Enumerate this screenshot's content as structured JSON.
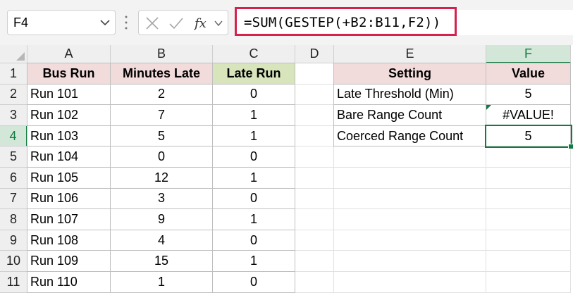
{
  "formula_bar": {
    "name_box": "F4",
    "formula": "=SUM(GESTEP(+B2:B11,F2))",
    "cancel_icon": "close-icon",
    "enter_icon": "check-icon",
    "function_icon": "fx-icon"
  },
  "columns": [
    "A",
    "B",
    "C",
    "D",
    "E",
    "F"
  ],
  "rows": [
    "1",
    "2",
    "3",
    "4",
    "5",
    "6",
    "7",
    "8",
    "9",
    "10",
    "11"
  ],
  "active_cell": {
    "column": "F",
    "row": "4"
  },
  "table1": {
    "headers": [
      "Bus Run",
      "Minutes Late",
      "Late Run"
    ],
    "rows": [
      [
        "Run 101",
        "2",
        "0"
      ],
      [
        "Run 102",
        "7",
        "1"
      ],
      [
        "Run 103",
        "5",
        "1"
      ],
      [
        "Run 104",
        "0",
        "0"
      ],
      [
        "Run 105",
        "12",
        "1"
      ],
      [
        "Run 106",
        "3",
        "0"
      ],
      [
        "Run 107",
        "9",
        "1"
      ],
      [
        "Run 108",
        "4",
        "0"
      ],
      [
        "Run 109",
        "15",
        "1"
      ],
      [
        "Run 110",
        "1",
        "0"
      ]
    ]
  },
  "table2": {
    "headers": [
      "Setting",
      "Value"
    ],
    "rows": [
      [
        "Late Threshold (Min)",
        "5"
      ],
      [
        "Bare Range Count",
        "#VALUE!"
      ],
      [
        "Coerced Range Count",
        "5"
      ]
    ]
  },
  "colors": {
    "header_pink": "#f2dcdb",
    "header_green": "#d8e4bc",
    "selection_green": "#107c41",
    "formula_highlight": "#d6204e"
  }
}
